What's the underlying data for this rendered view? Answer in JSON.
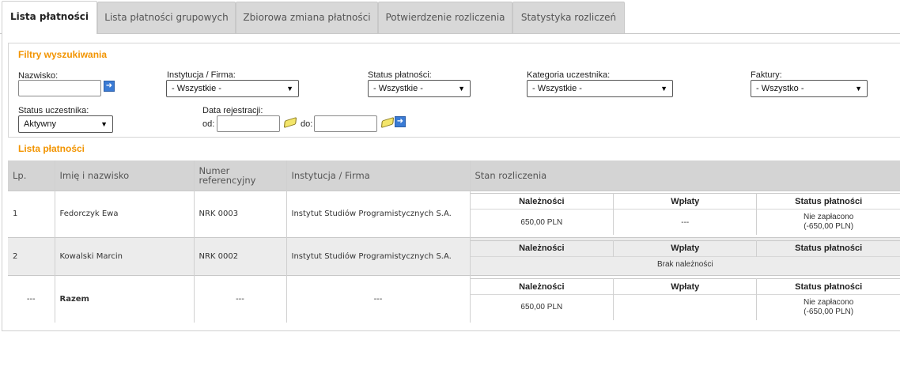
{
  "tabs": [
    {
      "label": "Lista płatności",
      "active": true
    },
    {
      "label": "Lista płatności grupowych",
      "active": false
    },
    {
      "label": "Zbiorowa zmiana płatności",
      "active": false
    },
    {
      "label": "Potwierdzenie rozliczenia",
      "active": false
    },
    {
      "label": "Statystyka rozliczeń",
      "active": false
    }
  ],
  "filters": {
    "title": "Filtry wyszukiwania",
    "surname_label": "Nazwisko:",
    "surname_value": "",
    "institution_label": "Instytucja / Firma:",
    "institution_value": "- Wszystkie -",
    "payment_status_label": "Status płatności:",
    "payment_status_value": "- Wszystkie -",
    "participant_category_label": "Kategoria uczestnika:",
    "participant_category_value": "- Wszystkie -",
    "invoices_label": "Faktury:",
    "invoices_value": "- Wszystko -",
    "participant_status_label": "Status uczestnika:",
    "participant_status_value": "Aktywny",
    "registration_date_label": "Data rejestracji:",
    "from_label": "od:",
    "to_label": "do:",
    "from_value": "",
    "to_value": ""
  },
  "list": {
    "title": "Lista płatności",
    "columns": [
      "Lp.",
      "Imię i nazwisko",
      "Numer referencyjny",
      "Instytucja / Firma",
      "Stan rozliczenia"
    ],
    "sub_headers": {
      "receivables": "Należności",
      "payments": "Wpłaty",
      "status": "Status płatności"
    },
    "rows": [
      {
        "lp": "1",
        "name": "Fedorczyk Ewa",
        "ref": "NRK 0003",
        "institution": "Instytut Studiów Programistycznych S.A.",
        "receivables": "650,00 PLN",
        "payments": "---",
        "status_line1": "Nie zapłacono",
        "status_line2": "(-650,00 PLN)"
      },
      {
        "lp": "2",
        "name": "Kowalski Marcin",
        "ref": "NRK 0002",
        "institution": "Instytut Studiów Programistycznych S.A.",
        "no_receivables": "Brak należności"
      }
    ],
    "total": {
      "lp": "---",
      "name": "Razem",
      "ref": "---",
      "institution": "---",
      "receivables": "650,00 PLN",
      "payments": "",
      "status_line1": "Nie zapłacono",
      "status_line2": "(-650,00 PLN)"
    }
  },
  "icons": {
    "go": "arrow-right-icon",
    "clear": "eraser-icon"
  },
  "colors": {
    "accent": "#f29400",
    "unpaid": "#e00000",
    "button": "#3a7bd5"
  }
}
